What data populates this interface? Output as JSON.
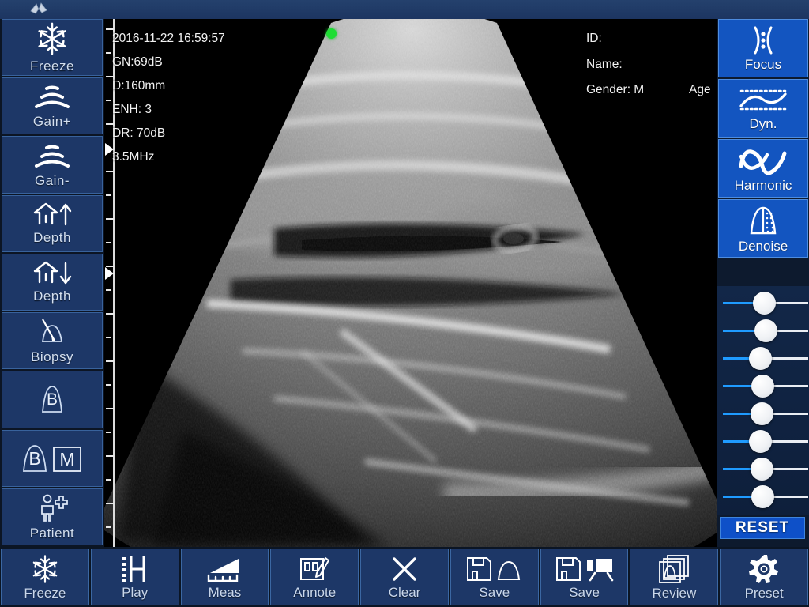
{
  "app": {
    "logo_name": "manufacturer-logo"
  },
  "sidebar": {
    "items": [
      {
        "label": "Freeze",
        "icon": "snowflake-icon",
        "name": "sidebar-item-freeze"
      },
      {
        "label": "Gain+",
        "icon": "gain-up-icon",
        "name": "sidebar-item-gain-up"
      },
      {
        "label": "Gain-",
        "icon": "gain-down-icon",
        "name": "sidebar-item-gain-down"
      },
      {
        "label": "Depth",
        "icon": "depth-up-icon",
        "name": "sidebar-item-depth-up"
      },
      {
        "label": "Depth",
        "icon": "depth-down-icon",
        "name": "sidebar-item-depth-down"
      },
      {
        "label": "Biopsy",
        "icon": "biopsy-needle-icon",
        "name": "sidebar-item-biopsy"
      },
      {
        "label": "",
        "icon": "b-mode-icon",
        "name": "sidebar-item-b-mode"
      },
      {
        "label": "",
        "icon": "bm-mode-icon",
        "name": "sidebar-item-bm-mode"
      },
      {
        "label": "Patient",
        "icon": "patient-add-icon",
        "name": "sidebar-item-patient"
      }
    ]
  },
  "image_overlay": {
    "left_lines": [
      "2016-11-22 16:59:57",
      "GN:69dB",
      "D:160mm",
      "ENH: 3",
      "DR: 70dB",
      "3.5MHz"
    ],
    "datetime": "2016-11-22 16:59:57",
    "gain": "GN:69dB",
    "depth": "D:160mm",
    "enhance": "ENH: 3",
    "dynamic_range": "DR: 70dB",
    "frequency": "3.5MHz",
    "patient": {
      "id": "ID:",
      "name": "Name:",
      "gender": "Gender: M",
      "age": "Age"
    },
    "orientation_marker_color": "#1ddd33"
  },
  "right_panel": {
    "buttons": [
      {
        "label": "Focus",
        "icon": "focus-icon",
        "name": "right-button-focus"
      },
      {
        "label": "Dyn.",
        "icon": "dynamic-icon",
        "name": "right-button-dyn"
      },
      {
        "label": "Harmonic",
        "icon": "harmonic-icon",
        "name": "right-button-harmonic"
      },
      {
        "label": "Denoise",
        "icon": "denoise-icon",
        "name": "right-button-denoise"
      }
    ],
    "tgc": {
      "name": "tgc-slider-group",
      "count": 8,
      "values": [
        48,
        50,
        42,
        46,
        44,
        42,
        44,
        46
      ]
    },
    "reset_label": "RESET",
    "accent_color": "#1355c0"
  },
  "bottom_toolbar": {
    "buttons": [
      {
        "label": "Freeze",
        "icon": "snowflake-icon",
        "name": "toolbar-freeze"
      },
      {
        "label": "Play",
        "icon": "film-play-icon",
        "name": "toolbar-play"
      },
      {
        "label": "Meas",
        "icon": "measure-icon",
        "name": "toolbar-meas"
      },
      {
        "label": "Annote",
        "icon": "annotate-pencil-icon",
        "name": "toolbar-annote"
      },
      {
        "label": "Clear",
        "icon": "x-clear-icon",
        "name": "toolbar-clear"
      },
      {
        "label": "Save",
        "icon": "save-image-icon",
        "name": "toolbar-save-image"
      },
      {
        "label": "Save",
        "icon": "save-video-icon",
        "name": "toolbar-save-video"
      },
      {
        "label": "Review",
        "icon": "review-stack-icon",
        "name": "toolbar-review"
      },
      {
        "label": "Preset",
        "icon": "gear-icon",
        "name": "toolbar-preset"
      }
    ]
  },
  "ruler": {
    "focus_markers": [
      165,
      322
    ]
  },
  "colors": {
    "panel_blue": "#1d3767",
    "accent_blue": "#1355c0",
    "background": "#18304f",
    "image_black": "#000000"
  }
}
